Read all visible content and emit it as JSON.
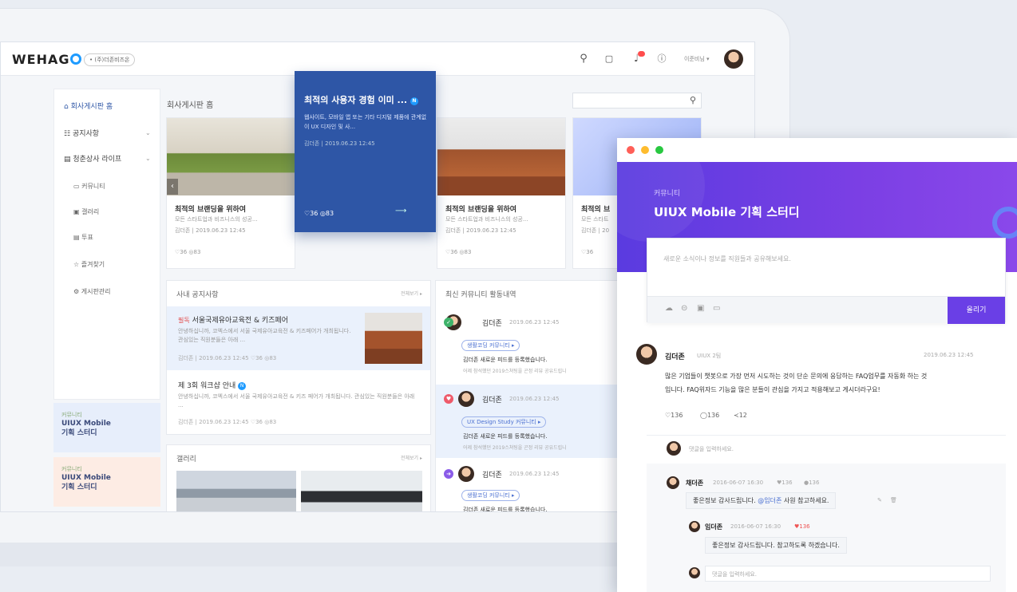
{
  "app": {
    "logo": "WEHAGO",
    "company": "• (주)더존비즈온",
    "user": "이준비님 ▾"
  },
  "topbar_icons": [
    "search-icon",
    "message-icon",
    "bell-icon",
    "help-icon"
  ],
  "sidebar": {
    "home": "회사게시판 홈",
    "items": [
      {
        "label": "공지사항"
      },
      {
        "label": "청춘상사 라이프"
      }
    ],
    "subitems": [
      "커뮤니티",
      "갤러리",
      "투표",
      "즐겨찾기",
      "게시판관리"
    ],
    "cards": [
      {
        "cat": "커뮤니티",
        "title1": "UIUX Mobile",
        "title2": "기획 스터디"
      },
      {
        "cat": "커뮤니티",
        "title1": "UIUX Mobile",
        "title2": "기획 스터디"
      }
    ]
  },
  "board": {
    "title": "회사게시판 홈"
  },
  "cards": [
    {
      "title": "최적의 브랜딩을 위하여",
      "sub": "모든 스타트업과 비즈니스의 성공...",
      "meta": "김더존 | 2019.06.23 12:45",
      "counts": "♡36  ◎83"
    },
    {
      "title": "최적의 브랜딩을 위하여",
      "sub": "모든 스타트업과 비즈니스의 성공...",
      "meta": "김더존 | 2019.06.23 12:45",
      "counts": "♡36  ◎83"
    },
    {
      "title": "최적의 브",
      "sub": "모든 스타트",
      "meta": "김더존 | 20",
      "counts": "♡36"
    }
  ],
  "feature": {
    "title": "최적의 사용자 경험 이미 ...",
    "sub": "웹사이트, 모바일 앱 또는 기타 디지털 제품에 관계없이 UX 디자인 및 사...",
    "meta": "김더존 | 2019.06.23 12:45",
    "counts": "♡36  ◎83"
  },
  "notice": {
    "header": "사내 공지사항",
    "more": "전체보기 ▸",
    "items": [
      {
        "badge": "필독",
        "title": "서울국제유아교육전 & 키즈페어",
        "sub": "안녕하십니까, 코엑스에서 서울 국제유아교육전 & 키즈페어가 개최됩니다. 관심있는 직원분들은 아래 ...",
        "meta": "김더존 | 2019.06.23 12:45  ♡36  ◎83"
      },
      {
        "title": "제 3회 워크샵 안내",
        "sub": "안녕하십니까, 코엑스에서 서울 국제유아교육전 & 키즈 페어가 개최됩니다. 관심있는 직원분들은 아래 ...",
        "meta": "김더존 | 2019.06.23 12:45  ♡36  ◎83"
      }
    ]
  },
  "gallery": {
    "header": "갤러리",
    "more": "전체보기 ▸"
  },
  "activity": {
    "header": "최신 커뮤니티 활동내역",
    "items": [
      {
        "name": "김더존",
        "time": "2019.06.23 12:45",
        "tag": "생활코딩 커뮤니티 ▸",
        "text": "김더존 새로운 피드를 등록했습니다.",
        "sub": "어제 참석했던 2019스쳐팅을 곤정 리뷰 공유드립니"
      },
      {
        "name": "김더존",
        "time": "2019.06.23 12:45",
        "tag": "UX Design Study 커뮤니티 ▸",
        "text": "김더존 새로운 피드를 등록했습니다.",
        "sub": "어제 참석했던 2019스쳐팅을 곤정 리뷰 공유드립니"
      },
      {
        "name": "김더존",
        "time": "2019.06.23 12:45",
        "tag": "생활코딩 커뮤니티 ▸",
        "text": "김더존 새로운 피드를 등록했습니다.",
        "sub": ""
      }
    ]
  },
  "modal": {
    "category": "커뮤니티",
    "title": "UIUX Mobile 기획 스터디",
    "composer_placeholder": "새로운 소식이나 정보를 직원들과 공유해보세요.",
    "post_button": "올리기",
    "post": {
      "author": "김더존",
      "role": "UIUX 2팀",
      "time": "2019.06.23 12:45",
      "line1": "많은 기업들이 챗봇으로 가장 먼저 시도하는 것이 단순 문의에 응답하는 FAQ업무를 자동화 하는 것",
      "line2": "입니다. FAQ위자드 기능을 많은 분들이 관심을 가지고 적용해보고 게시더라구요!",
      "likes": "♡136",
      "comments": "◯136",
      "shares": "≺12"
    },
    "comment_placeholder": "댓글을 입력하세요.",
    "replies": [
      {
        "name": "채더존",
        "time": "2016-06-07 16:30",
        "likes": "♥136",
        "comments": "●136",
        "text": "좋은정보 감사드립니다.",
        "mention": "@임더존",
        "text2": "사원 참고하세요."
      },
      {
        "name": "임더존",
        "time": "2016-06-07 16:30",
        "likes": "♥136",
        "text": "좋은정보 감사드립니다. 참고하도록 하겠습니다."
      }
    ],
    "reply_placeholder": "댓글을 입력하세요."
  },
  "colors": {
    "accent": "#6a3fe6",
    "blue": "#2e56a6",
    "brand": "#1e9bff"
  }
}
